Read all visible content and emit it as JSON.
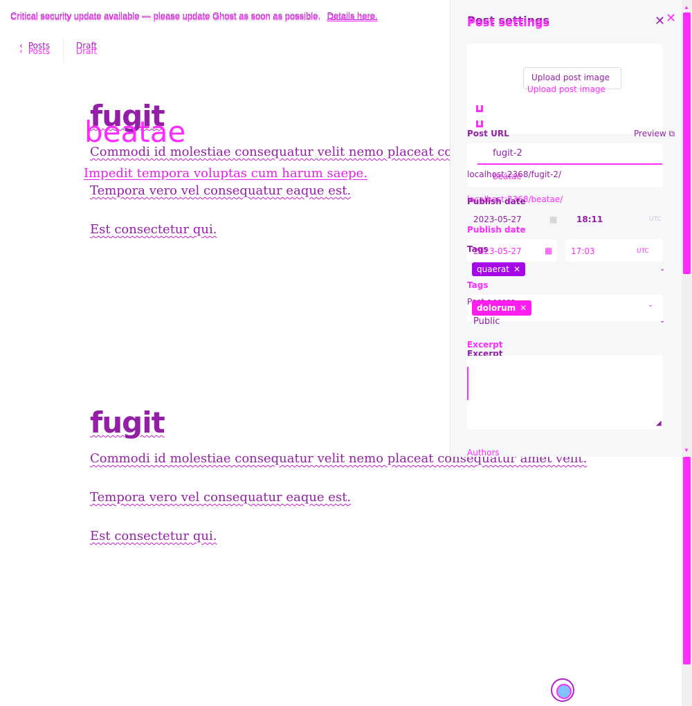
{
  "banner": {
    "message": "Critical security update available — please update Ghost as soon as possible.",
    "link": "Details here."
  },
  "breadcrumb": {
    "back_label": "Posts",
    "status": "Draft"
  },
  "editor": {
    "title_a": "fugit",
    "title_b": "beatae",
    "p1": "Commodi id molestiae consequatur velit nemo placeat con",
    "p1_full": "Commodi id molestiae consequatur velit nemo placeat consequatur amet velit.",
    "p_b": "Impedit tempora voluptas cum harum saepe.",
    "p2": "Tempora vero vel consequatur eaque est.",
    "p3": "Est consectetur qui."
  },
  "settings": {
    "title": "Post settings",
    "upload_label": "Upload post image",
    "url_label": "Post URL",
    "preview_label": "Preview",
    "slug_a": "fugit-2",
    "slug_b": "beatae",
    "url_help_a": "localhost:2368/fugit-2/",
    "url_help_b": "localhost:2368/beatae/",
    "publish_label": "Publish date",
    "date_a": "2023-05-27",
    "time_a": "18:11",
    "date_b": "2023-05-27",
    "time_b": "17:03",
    "timezone": "UTC",
    "tags_label": "Tags",
    "tag_a": "quaerat",
    "tag_b": "dolorum",
    "access_label": "Post access",
    "access_value": "Public",
    "excerpt_label": "Excerpt",
    "authors_label": "Authors"
  },
  "colors": {
    "variant_a": "#931fa6",
    "variant_b": "#ff2cff",
    "tag_a_bg": "#a50ae6",
    "tag_b_bg": "#ff1eee"
  },
  "icons": {
    "close": "close-icon",
    "back": "chevron-left-icon",
    "calendar": "calendar-icon",
    "external": "external-link-icon",
    "select": "chevron-down-icon",
    "help": "help-icon"
  }
}
